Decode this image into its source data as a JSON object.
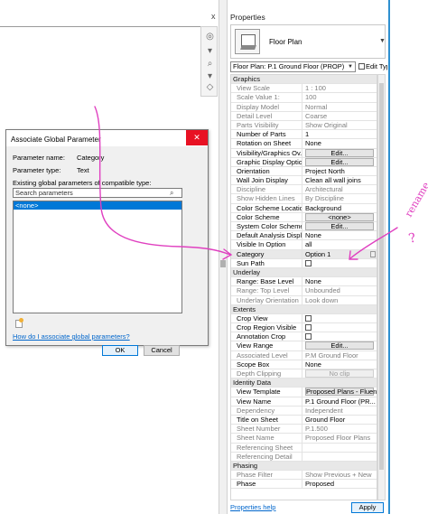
{
  "properties": {
    "title": "Properties",
    "type_name": "Floor Plan",
    "instance_filter": "Floor Plan: P.1   Ground Floor (PROP)",
    "edit_type_label": "Edit Type",
    "help_link": "Properties help",
    "apply_label": "Apply",
    "rows": [
      {
        "kind": "group",
        "name": "Graphics"
      },
      {
        "name": "View Scale",
        "value": "1 : 100",
        "ro": true
      },
      {
        "name": "Scale Value   1:",
        "value": "100",
        "ro": true
      },
      {
        "name": "Display Model",
        "value": "Normal",
        "ro": true
      },
      {
        "name": "Detail Level",
        "value": "Coarse",
        "ro": true
      },
      {
        "name": "Parts Visibility",
        "value": "Show Original",
        "ro": true
      },
      {
        "name": "Number of Parts",
        "value": "1"
      },
      {
        "name": "Rotation on Sheet",
        "value": "None"
      },
      {
        "name": "Visibility/Graphics Ov...",
        "value": "Edit...",
        "button": true
      },
      {
        "name": "Graphic Display Options",
        "value": "Edit...",
        "button": true
      },
      {
        "name": "Orientation",
        "value": "Project North"
      },
      {
        "name": "Wall Join Display",
        "value": "Clean all wall joins"
      },
      {
        "name": "Discipline",
        "value": "Architectural",
        "ro": true
      },
      {
        "name": "Show Hidden Lines",
        "value": "By Discipline",
        "ro": true
      },
      {
        "name": "Color Scheme Location",
        "value": "Background"
      },
      {
        "name": "Color Scheme",
        "value": "<none>",
        "button": true
      },
      {
        "name": "System Color Schemes",
        "value": "Edit...",
        "button": true
      },
      {
        "name": "Default Analysis Displ...",
        "value": "None"
      },
      {
        "name": "Visible In Option",
        "value": "all"
      },
      {
        "name": "Category",
        "value": "Option 1",
        "selected": true
      },
      {
        "name": "Sun Path",
        "value": "",
        "checkbox": true
      },
      {
        "kind": "group",
        "name": "Underlay"
      },
      {
        "name": "Range: Base Level",
        "value": "None"
      },
      {
        "name": "Range: Top Level",
        "value": "Unbounded",
        "ro": true
      },
      {
        "name": "Underlay Orientation",
        "value": "Look down",
        "ro": true
      },
      {
        "kind": "group",
        "name": "Extents"
      },
      {
        "name": "Crop View",
        "value": "",
        "checkbox": true
      },
      {
        "name": "Crop Region Visible",
        "value": "",
        "checkbox": true
      },
      {
        "name": "Annotation Crop",
        "value": "",
        "checkbox": true
      },
      {
        "name": "View Range",
        "value": "Edit...",
        "button": true
      },
      {
        "name": "Associated Level",
        "value": "P.M   Ground Floor",
        "ro": true
      },
      {
        "name": "Scope Box",
        "value": "None"
      },
      {
        "name": "Depth Clipping",
        "value": "No clip",
        "button": true,
        "ro": true
      },
      {
        "kind": "group",
        "name": "Identity Data"
      },
      {
        "name": "View Template",
        "value": "Proposed Plans - Fluent",
        "button": true
      },
      {
        "name": "View Name",
        "value": "P.1   Ground Floor (PR..."
      },
      {
        "name": "Dependency",
        "value": "Independent",
        "ro": true
      },
      {
        "name": "Title on Sheet",
        "value": "Ground Floor"
      },
      {
        "name": "Sheet Number",
        "value": "P.1.500",
        "ro": true
      },
      {
        "name": "Sheet Name",
        "value": "Proposed Floor Plans",
        "ro": true
      },
      {
        "name": "Referencing Sheet",
        "value": "",
        "ro": true
      },
      {
        "name": "Referencing Detail",
        "value": "",
        "ro": true
      },
      {
        "kind": "group",
        "name": "Phasing"
      },
      {
        "name": "Phase Filter",
        "value": "Show Previous + New",
        "ro": true
      },
      {
        "name": "Phase",
        "value": "Proposed"
      }
    ]
  },
  "dialog": {
    "title": "Associate Global Parameter",
    "close_symbol": "✕",
    "param_name_label": "Parameter name:",
    "param_name_value": "Category",
    "param_type_label": "Parameter type:",
    "param_type_value": "Text",
    "existing_label": "Existing global parameters of compatible type:",
    "search_value": "Search parameters",
    "list_items": [
      "<none>"
    ],
    "help_link": "How do I associate global parameters?",
    "ok_label": "OK",
    "cancel_label": "Cancel"
  },
  "annotation": {
    "handwritten": "rename",
    "question": "?",
    "color": "#e040c0"
  },
  "canvas": {
    "close_symbol": "x"
  }
}
